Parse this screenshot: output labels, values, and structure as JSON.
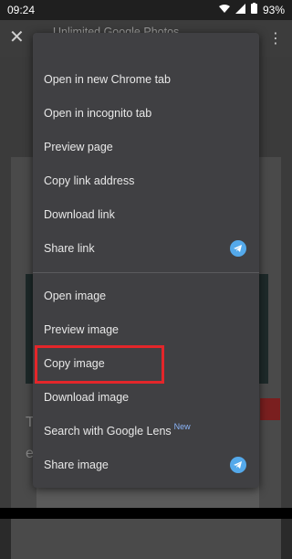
{
  "status_bar": {
    "time": "09:24",
    "battery": "93%"
  },
  "toolbar": {
    "title": "Unlimited Google Photos...",
    "url": "p"
  },
  "page_background": {
    "fragment_t": "T",
    "fragment_e": "e"
  },
  "menu": {
    "items": [
      {
        "label": "Open in new Chrome tab"
      },
      {
        "label": "Open in incognito tab"
      },
      {
        "label": "Preview page"
      },
      {
        "label": "Copy link address"
      },
      {
        "label": "Download link"
      },
      {
        "label": "Share link"
      },
      {
        "label": "Open image"
      },
      {
        "label": "Preview image"
      },
      {
        "label": "Copy image"
      },
      {
        "label": "Download image"
      },
      {
        "label": "Search with Google Lens",
        "badge": "New"
      },
      {
        "label": "Share image"
      }
    ]
  },
  "colors": {
    "menu_bg": "#404043",
    "highlight": "#e3262a",
    "telegram": "#54a9eb",
    "new_badge": "#8ab4f8"
  },
  "icons": [
    "close-icon",
    "more-vert-icon",
    "wifi-icon",
    "signal-icon",
    "battery-icon",
    "telegram-icon"
  ]
}
